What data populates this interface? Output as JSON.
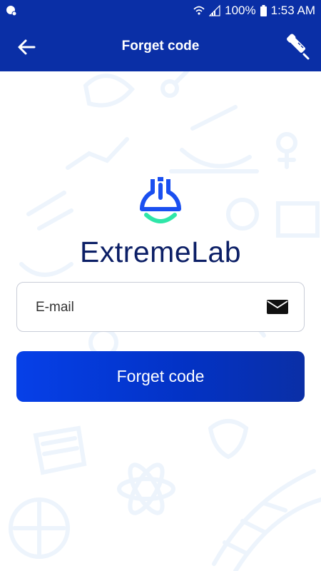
{
  "status_bar": {
    "battery": "100%",
    "time": "1:53 AM"
  },
  "header": {
    "title": "Forget code"
  },
  "brand": {
    "name": "ExtremeLab"
  },
  "form": {
    "email_placeholder": "E-mail",
    "submit_label": "Forget code"
  },
  "colors": {
    "primary": "#0a2fa6",
    "button": "#0640e8",
    "brand_text": "#0c1f66",
    "logo_blue": "#1a4ff0",
    "logo_green": "#2ee6a8"
  }
}
